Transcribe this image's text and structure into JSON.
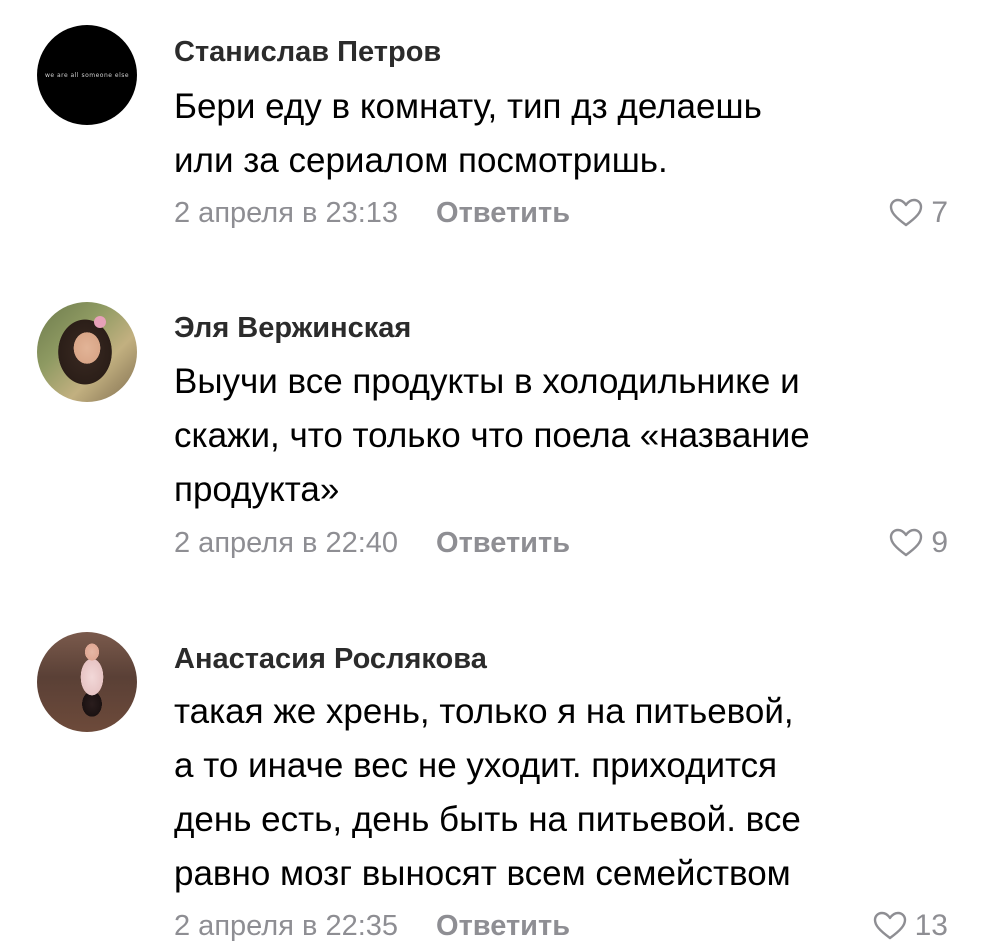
{
  "comments": [
    {
      "author": "Станислав Петров",
      "avatar_text": "we are all someone else",
      "lines": [
        "Бери еду в комнату, тип дз делаешь",
        "или за сериалом посмотришь."
      ],
      "date": "2 апреля в 23:13",
      "reply_label": "Ответить",
      "likes": "7"
    },
    {
      "author": "Эля Вержинская",
      "lines": [
        "Выучи все продукты в холодильнике и",
        "скажи, что только что поела «название",
        "продукта»"
      ],
      "date": "2 апреля в 22:40",
      "reply_label": "Ответить",
      "likes": "9"
    },
    {
      "author": "Анастасия Рослякова",
      "lines": [
        "такая же хрень, только я на питьевой,",
        "а то иначе вес не уходит. приходится",
        "день есть, день быть на питьевой. все",
        "равно мозг выносят всем семейством"
      ],
      "date": "2 апреля в 22:35",
      "reply_label": "Ответить",
      "likes": "13"
    }
  ]
}
